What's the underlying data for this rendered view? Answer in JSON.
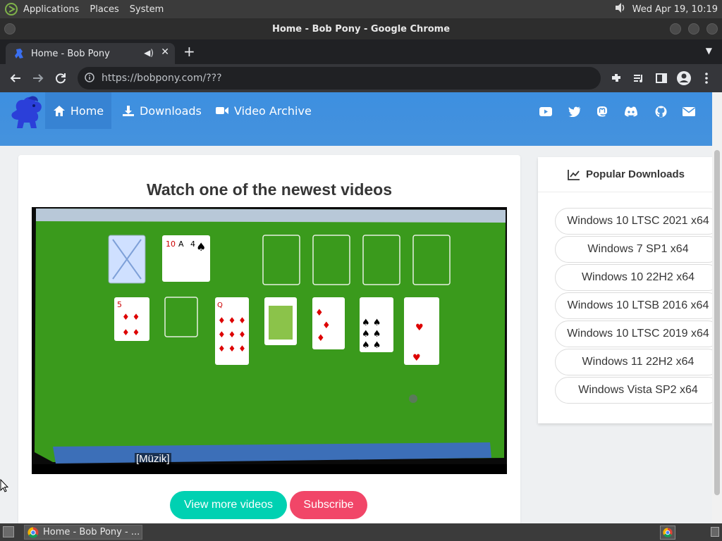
{
  "os_panel": {
    "menus": [
      "Applications",
      "Places",
      "System"
    ],
    "clock": "Wed Apr 19, 10:19"
  },
  "window": {
    "title": "Home - Bob Pony - Google Chrome"
  },
  "tab": {
    "title": "Home - Bob Pony"
  },
  "address_bar": {
    "url": "https://bobpony.com/???"
  },
  "navbar": {
    "items": [
      {
        "label": "Home",
        "icon": "home-icon"
      },
      {
        "label": "Downloads",
        "icon": "download-icon"
      },
      {
        "label": "Video Archive",
        "icon": "video-camera-icon"
      }
    ],
    "social_icons": [
      "youtube-icon",
      "twitter-icon",
      "mastodon-icon",
      "discord-icon",
      "github-icon",
      "email-icon"
    ],
    "brand_color": "#3d8fe0"
  },
  "main": {
    "title": "Watch one of the newest videos",
    "video_caption": "[Müzik]",
    "buttons": {
      "view_more": "View more videos",
      "subscribe": "Subscribe"
    },
    "colors": {
      "view_more": "#00d1b2",
      "subscribe": "#f14668"
    }
  },
  "sidebar": {
    "title": "Popular Downloads",
    "items": [
      "Windows 10 LTSC 2021 x64",
      "Windows 7 SP1 x64",
      "Windows 10 22H2 x64",
      "Windows 10 LTSB 2016 x64",
      "Windows 10 LTSC 2019 x64",
      "Windows 11 22H2 x64",
      "Windows Vista SP2 x64"
    ]
  },
  "taskbar": {
    "window_label": "Home - Bob Pony - ..."
  }
}
